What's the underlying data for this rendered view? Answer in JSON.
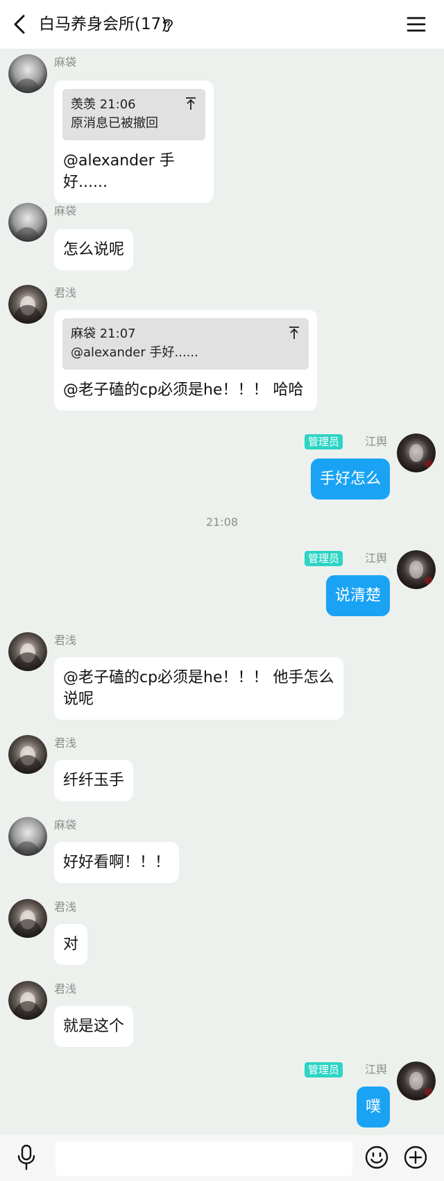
{
  "header": {
    "title": "白马养身会所(17)"
  },
  "time_divider": "21:08",
  "messages": [
    {
      "sender": "麻袋",
      "quote": {
        "head": "羡羡 21:06",
        "text": "原消息已被撤回"
      },
      "text": "@alexander 手好......"
    },
    {
      "sender": "麻袋",
      "text": "怎么说呢"
    },
    {
      "sender": "君浅",
      "quote": {
        "head": "麻袋 21:07",
        "text": "@alexander 手好......"
      },
      "text": "@老子磕的cp必须是he！！！ 哈哈"
    },
    {
      "sender": "江舆",
      "badge": "管理员",
      "text": "手好怎么"
    },
    {
      "sender": "江舆",
      "badge": "管理员",
      "text": "说清楚"
    },
    {
      "sender": "君浅",
      "text": "@老子磕的cp必须是he！！！ 他手怎么说呢"
    },
    {
      "sender": "君浅",
      "text": "纤纤玉手"
    },
    {
      "sender": "麻袋",
      "text": "好好看啊！！！"
    },
    {
      "sender": "君浅",
      "text": "对"
    },
    {
      "sender": "君浅",
      "text": "就是这个"
    },
    {
      "sender": "江舆",
      "badge": "管理员",
      "text": "噗"
    }
  ],
  "input": {
    "placeholder": ""
  },
  "icons": [
    "back-arrow-icon",
    "ear-icon",
    "menu-icon",
    "microphone-icon",
    "emoji-icon",
    "plus-icon"
  ],
  "colors": {
    "background": "#edf1ee",
    "my_bubble": "#1aa3f4",
    "admin_badge": "#2ed4c4"
  }
}
